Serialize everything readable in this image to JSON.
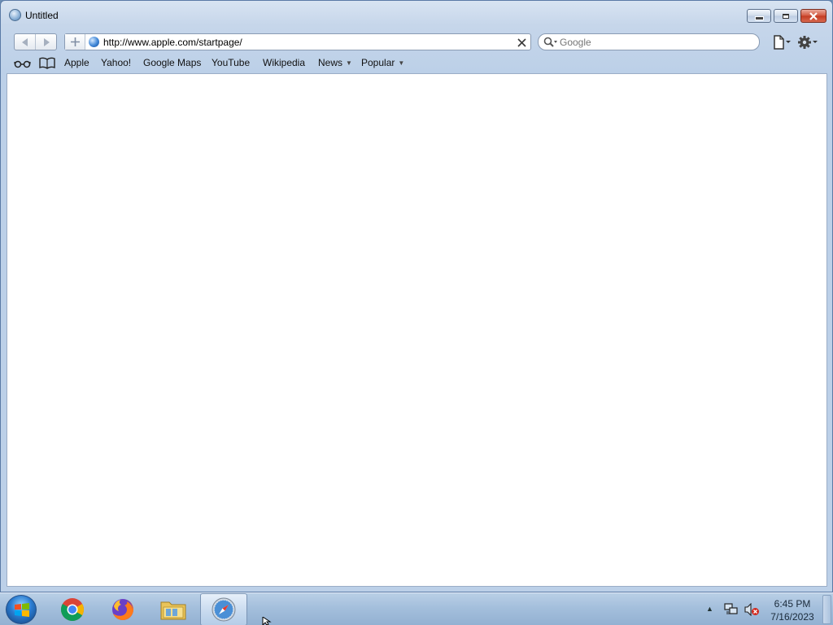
{
  "window": {
    "title": "Untitled"
  },
  "toolbar": {
    "url": "http://www.apple.com/startpage/",
    "search_placeholder": "Google"
  },
  "bookmarks": {
    "items": [
      {
        "label": "Apple"
      },
      {
        "label": "Yahoo!"
      },
      {
        "label": "Google Maps"
      },
      {
        "label": "YouTube"
      },
      {
        "label": "Wikipedia"
      },
      {
        "label": "News",
        "dropdown": true
      },
      {
        "label": "Popular",
        "dropdown": true
      }
    ]
  },
  "taskbar": {
    "apps": [
      {
        "name": "chrome-icon"
      },
      {
        "name": "firefox-icon"
      },
      {
        "name": "file-explorer-icon"
      },
      {
        "name": "safari-icon",
        "active": true
      }
    ],
    "clock": {
      "time": "6:45 PM",
      "date": "7/16/2023"
    }
  }
}
